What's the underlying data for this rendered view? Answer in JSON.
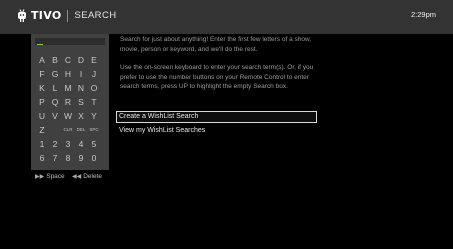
{
  "header": {
    "brand": "TIVO",
    "screen_title": "SEARCH",
    "clock": "2:29pm"
  },
  "keyboard": {
    "rows": [
      [
        "A",
        "B",
        "C",
        "D",
        "E"
      ],
      [
        "F",
        "G",
        "H",
        "I",
        "J"
      ],
      [
        "K",
        "L",
        "M",
        "N",
        "O"
      ],
      [
        "P",
        "Q",
        "R",
        "S",
        "T"
      ],
      [
        "U",
        "V",
        "W",
        "X",
        "Y"
      ],
      [
        "Z",
        "CLR",
        "DEL",
        "SPC"
      ],
      [
        "1",
        "2",
        "3",
        "4",
        "5"
      ],
      [
        "6",
        "7",
        "8",
        "9",
        "0"
      ]
    ],
    "space_hint": "Space",
    "delete_hint": "Delete"
  },
  "instructions": {
    "para1": "Search for just about anything! Enter the first few letters of a show, movie, person or keyword, and we'll do the rest.",
    "para2": "Use the on-screen keyboard to enter your search term(s). Or, if you prefer to use the number buttons on your Remote Control to enter search terms, press UP to highlight the empty Search box."
  },
  "menu": [
    {
      "label": "Create a WishList Search",
      "selected": true
    },
    {
      "label": "View my WishList Searches",
      "selected": false
    }
  ]
}
